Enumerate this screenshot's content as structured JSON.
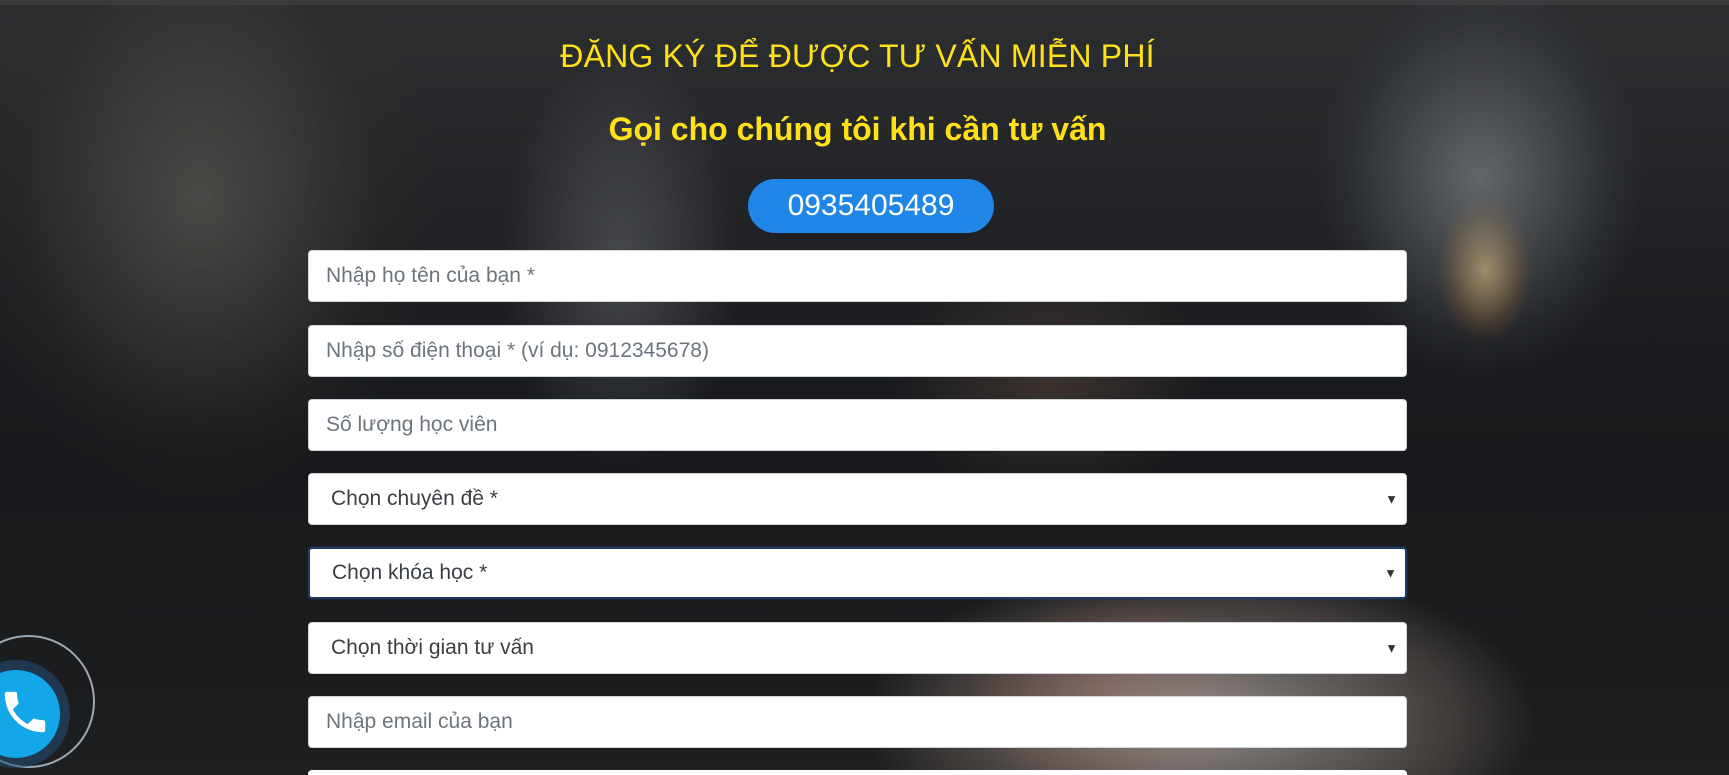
{
  "form": {
    "title": "ĐĂNG KÝ ĐỂ ĐƯỢC TƯ VẤN MIỄN PHÍ",
    "subtitle": "Gọi cho chúng tôi khi cần tư vấn",
    "phone_number": "0935405489",
    "fields": {
      "name_placeholder": "Nhập họ tên của bạn *",
      "phone_placeholder": "Nhập số điện thoại * (ví dụ: 0912345678)",
      "students_placeholder": "Số lượng học viên",
      "topic_selected": "Chọn chuyên đề *",
      "course_selected": "Chọn khóa học *",
      "time_selected": "Chọn thời gian tư vấn",
      "email_placeholder": "Nhập email của bạn"
    }
  },
  "colors": {
    "heading": "#ffe11a",
    "phone_button": "#1f86e8",
    "call_widget": "#13a6e8"
  },
  "icons": {
    "call_widget": "phone-icon",
    "select_caret": "caret-down-icon"
  }
}
